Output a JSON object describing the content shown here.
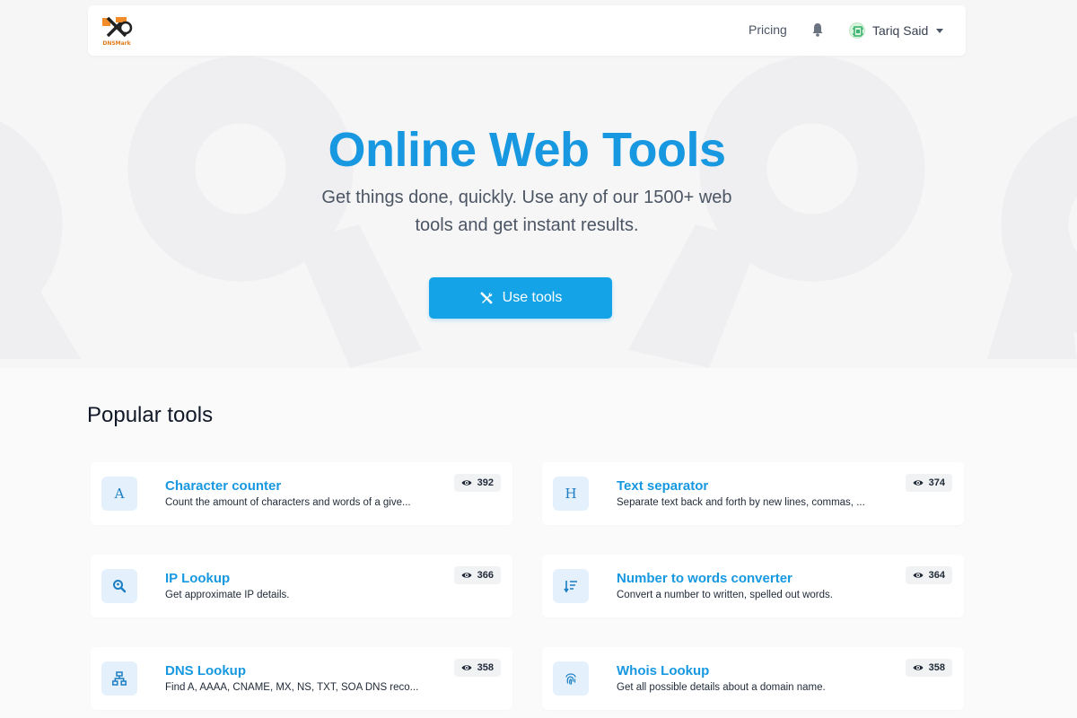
{
  "header": {
    "logo_text": "DNSMark",
    "pricing_label": "Pricing",
    "user_name": "Tariq Said"
  },
  "hero": {
    "title": "Online Web Tools",
    "subtitle": "Get things done, quickly. Use any of our 1500+ web tools and get instant results.",
    "button_label": "Use tools"
  },
  "popular": {
    "title": "Popular tools",
    "tools": [
      {
        "icon": "letter-a-icon",
        "glyph": "A",
        "title": "Character counter",
        "desc": "Count the amount of characters and words of a give...",
        "views": "392"
      },
      {
        "icon": "letter-h-icon",
        "glyph": "H",
        "title": "Text separator",
        "desc": "Separate text back and forth by new lines, commas, ...",
        "views": "374"
      },
      {
        "icon": "search-location-icon",
        "glyph": "",
        "title": "IP Lookup",
        "desc": "Get approximate IP details.",
        "views": "366"
      },
      {
        "icon": "sort-numeric-icon",
        "glyph": "",
        "title": "Number to words converter",
        "desc": "Convert a number to written, spelled out words.",
        "views": "364"
      },
      {
        "icon": "network-icon",
        "glyph": "",
        "title": "DNS Lookup",
        "desc": "Find A, AAAA, CNAME, MX, NS, TXT, SOA DNS reco...",
        "views": "358"
      },
      {
        "icon": "fingerprint-icon",
        "glyph": "",
        "title": "Whois Lookup",
        "desc": "Get all possible details about a domain name.",
        "views": "358"
      }
    ]
  },
  "colors": {
    "accent": "#1798e0",
    "button": "#13a3e6",
    "icon_bg": "#e4f1fc",
    "page_bg": "#fafafb"
  }
}
